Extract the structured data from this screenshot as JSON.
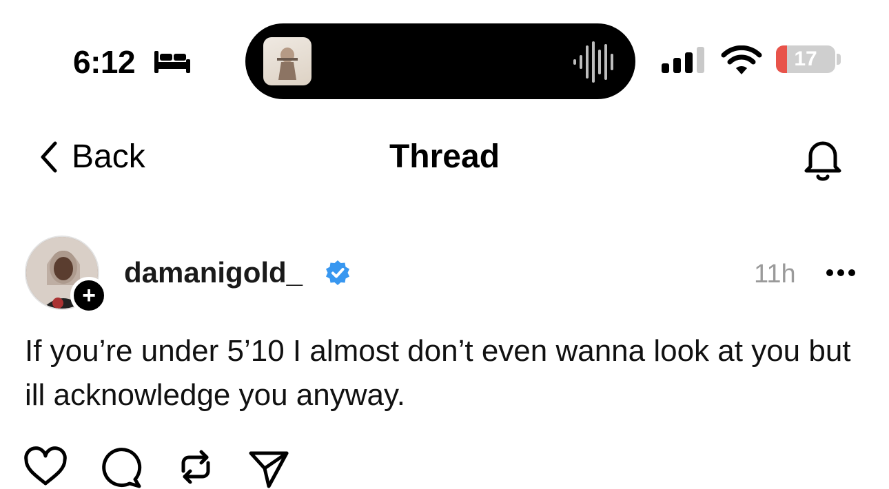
{
  "status_bar": {
    "time": "6:12",
    "focus_icon": "bed-icon",
    "live_activity": {
      "album_art": "album-art",
      "waveform_icon": "waveform-icon"
    },
    "signal_icon": "cellular-signal-icon",
    "wifi_icon": "wifi-icon",
    "battery_level": "17",
    "battery_color": "#e8534a"
  },
  "nav": {
    "back_label": "Back",
    "title": "Thread",
    "notification_icon": "bell-icon"
  },
  "post": {
    "username": "damanigold_",
    "verified": true,
    "verified_color": "#3897f0",
    "timestamp": "11h",
    "text": "If you’re under 5’10 I almost don’t even wanna look at you but ill acknowledge you anyway.",
    "follow_badge": "+",
    "actions": [
      "heart-icon",
      "comment-icon",
      "repost-icon",
      "share-icon"
    ]
  }
}
